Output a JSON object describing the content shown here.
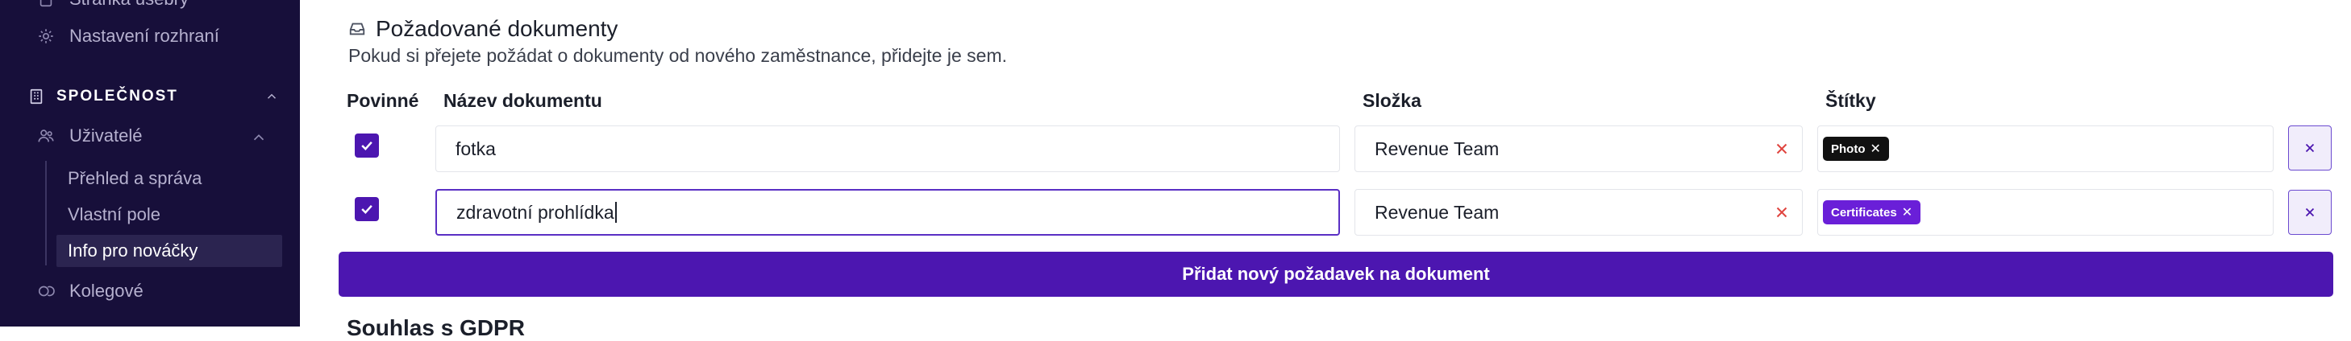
{
  "sidebar": {
    "items_top": [
      {
        "label": "Stránka ušebry",
        "icon": "doc-icon"
      },
      {
        "label": "Nastavení rozhraní",
        "icon": "gear-icon"
      }
    ],
    "section": {
      "label": "SPOLEČNOST",
      "icon": "building-icon"
    },
    "group": {
      "label": "Uživatelé",
      "icon": "users-icon"
    },
    "sub_items": [
      {
        "label": "Přehled a správa",
        "active": false
      },
      {
        "label": "Vlastní pole",
        "active": false
      },
      {
        "label": "Info pro nováčky",
        "active": true
      }
    ],
    "bottom_item": {
      "label": "Kolegové",
      "icon": "coins-icon"
    }
  },
  "main": {
    "title": "Požadované dokumenty",
    "title_icon": "inbox-icon",
    "subtitle": "Pokud si přejete požádat o dokumenty od nového zaměstnance, přidejte je sem.",
    "columns": {
      "required": "Povinné",
      "name": "Název dokumentu",
      "folder": "Složka",
      "tags": "Štítky"
    },
    "rows": [
      {
        "required": true,
        "name": "fotka",
        "folder": "Revenue Team",
        "tag": "Photo",
        "tag_color": "#111111",
        "focused": false
      },
      {
        "required": true,
        "name": "zdravotní prohlídka",
        "folder": "Revenue Team",
        "tag": "Certificates",
        "tag_color": "#6a1fd8",
        "focused": true
      }
    ],
    "add_button": "Přidat nový požadavek na dokument",
    "next_section_title": "Souhlas s GDPR"
  },
  "colors": {
    "primary": "#4c16b0",
    "sidebar_bg": "#170f3a",
    "danger": "#e0443f"
  }
}
